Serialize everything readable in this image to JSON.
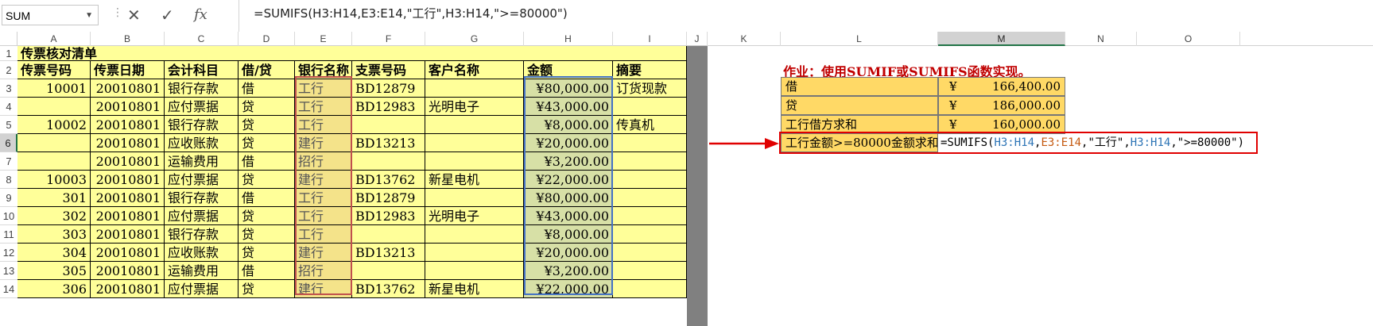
{
  "formula_bar": {
    "name_box": "SUM",
    "cancel_icon": "✕",
    "enter_icon": "✓",
    "fx_label": "fx",
    "formula": "=SUMIFS(H3:H14,E3:E14,\"工行\",H3:H14,\">=80000\")"
  },
  "columns": [
    "A",
    "B",
    "C",
    "D",
    "E",
    "F",
    "G",
    "H",
    "I",
    "J",
    "K",
    "L",
    "M",
    "N",
    "O"
  ],
  "rows": [
    "1",
    "2",
    "3",
    "4",
    "5",
    "6",
    "7",
    "8",
    "9",
    "10",
    "11",
    "12",
    "13",
    "14"
  ],
  "sheet": {
    "title": "传票核对清单",
    "headers": [
      "传票号码",
      "传票日期",
      "会计科目",
      "借/贷",
      "银行名称",
      "支票号码",
      "客户名称",
      "金额",
      "摘要"
    ],
    "data": [
      [
        "10001",
        "20010801",
        "银行存款",
        "借",
        "工行",
        "BD12879",
        "",
        "¥80,000.00",
        "订货现款"
      ],
      [
        "",
        "20010801",
        "应付票据",
        "贷",
        "工行",
        "BD12983",
        "光明电子",
        "¥43,000.00",
        ""
      ],
      [
        "10002",
        "20010801",
        "银行存款",
        "贷",
        "工行",
        "",
        "",
        "¥8,000.00",
        "传真机"
      ],
      [
        "",
        "20010801",
        "应收账款",
        "贷",
        "建行",
        "BD13213",
        "",
        "¥20,000.00",
        ""
      ],
      [
        "",
        "20010801",
        "运输费用",
        "借",
        "招行",
        "",
        "",
        "¥3,200.00",
        ""
      ],
      [
        "10003",
        "20010801",
        "应付票据",
        "贷",
        "建行",
        "BD13762",
        "新星电机",
        "¥22,000.00",
        ""
      ],
      [
        "301",
        "20010801",
        "银行存款",
        "借",
        "工行",
        "BD12879",
        "",
        "¥80,000.00",
        ""
      ],
      [
        "302",
        "20010801",
        "应付票据",
        "贷",
        "工行",
        "BD12983",
        "光明电子",
        "¥43,000.00",
        ""
      ],
      [
        "303",
        "20010801",
        "银行存款",
        "贷",
        "工行",
        "",
        "",
        "¥8,000.00",
        ""
      ],
      [
        "304",
        "20010801",
        "应收账款",
        "贷",
        "建行",
        "BD13213",
        "",
        "¥20,000.00",
        ""
      ],
      [
        "305",
        "20010801",
        "运输费用",
        "借",
        "招行",
        "",
        "",
        "¥3,200.00",
        ""
      ],
      [
        "306",
        "20010801",
        "应付票据",
        "贷",
        "建行",
        "BD13762",
        "新星电机",
        "¥22,000.00",
        ""
      ]
    ]
  },
  "task_note": "作业：使用SUMIF或SUMIFS函数实现。",
  "summary": [
    {
      "label": "借",
      "currency": "¥",
      "value": "166,400.00"
    },
    {
      "label": "贷",
      "currency": "¥",
      "value": "186,000.00"
    },
    {
      "label": "工行借方求和",
      "currency": "¥",
      "value": "160,000.00"
    }
  ],
  "editing": {
    "label": "工行金额>=80000金额求和",
    "formula_parts": [
      "=SUMIFS(",
      "H3:H14",
      ",",
      "E3:E14",
      ",\"工行\",",
      "H3:H14",
      ",\">=80000\")"
    ]
  },
  "colors": {
    "accent": "#e00000",
    "sheet_fill": "#ffff99",
    "summary_fill": "#ffd966"
  }
}
